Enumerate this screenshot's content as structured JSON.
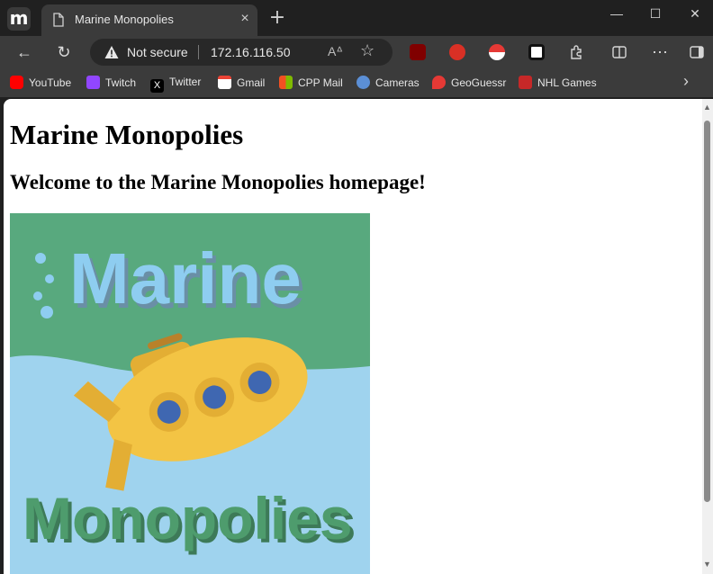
{
  "tab": {
    "title": "Marine Monopolies",
    "close_icon": "×"
  },
  "window": {
    "minimize": "—",
    "maximize": "☐",
    "close": "✕",
    "new_tab": "+"
  },
  "address_bar": {
    "security_label": "Not secure",
    "url": "172.16.116.50"
  },
  "toolbar": {
    "back": "←",
    "refresh": "↻",
    "read_aloud": "A͏ᐞ",
    "favorite": "☆",
    "more": "⋯"
  },
  "bookmarks": [
    {
      "label": "YouTube",
      "color": "#ff0000"
    },
    {
      "label": "Twitch",
      "color": "#9146ff"
    },
    {
      "label": "Twitter",
      "color": "#000000"
    },
    {
      "label": "Gmail",
      "color": "#ea4335"
    },
    {
      "label": "CPP Mail",
      "color": "#0078d4"
    },
    {
      "label": "Cameras",
      "color": "#5b8fd6"
    },
    {
      "label": "GeoGuessr",
      "color": "#e53935"
    },
    {
      "label": "NHL Games",
      "color": "#c62828"
    }
  ],
  "page": {
    "heading": "Marine Monopolies",
    "subheading": "Welcome to the Marine Monopolies homepage!",
    "logo_text_top": "Marine",
    "logo_text_bottom": "Monopolies"
  },
  "colors": {
    "logo_green": "#58a97e",
    "logo_water": "#9fd3ee",
    "logo_letters_blue": "#8ecdf0",
    "logo_letters_green": "#4e9c6d",
    "submarine": "#f3c444",
    "porthole": "#3f67b1"
  }
}
